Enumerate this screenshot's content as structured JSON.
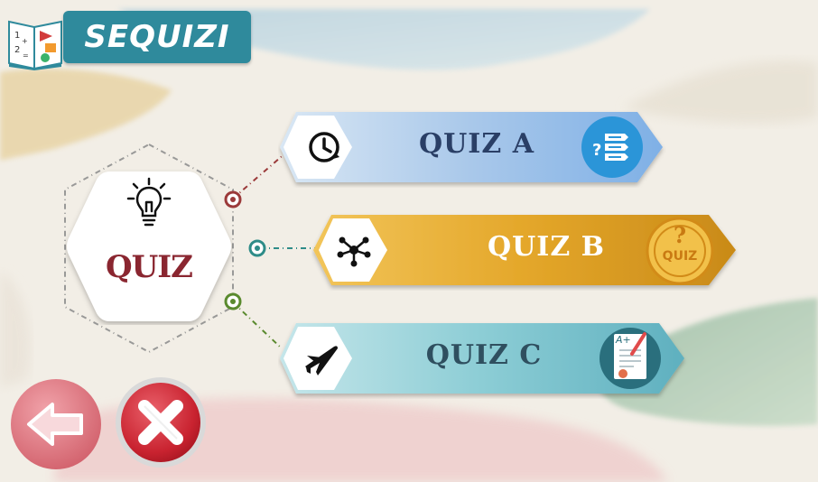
{
  "app": {
    "title": "SEQUIZI"
  },
  "center": {
    "label": "QUIZ",
    "icon": "lightbulb-icon"
  },
  "quizzes": [
    {
      "label": "QUIZ A",
      "left_icon": "clock-icon",
      "right_icon": "question-list-icon",
      "color": "#a8c6e6"
    },
    {
      "label": "QUIZ B",
      "left_icon": "network-icon",
      "right_icon": "quiz-badge-icon",
      "badge_text_top": "?",
      "badge_text_bottom": "QUIZ",
      "color": "#e5a92b"
    },
    {
      "label": "QUIZ C",
      "left_icon": "airplane-icon",
      "right_icon": "graded-paper-icon",
      "badge_text": "A+",
      "color": "#7cc6cf"
    }
  ],
  "controls": {
    "back_icon": "arrow-left-icon",
    "close_icon": "close-icon"
  },
  "colors": {
    "accent_red": "#8a2630",
    "quiz_a_text": "#2a3f66",
    "quiz_b_text": "#ffffff",
    "quiz_c_text": "#2f4f5f"
  }
}
